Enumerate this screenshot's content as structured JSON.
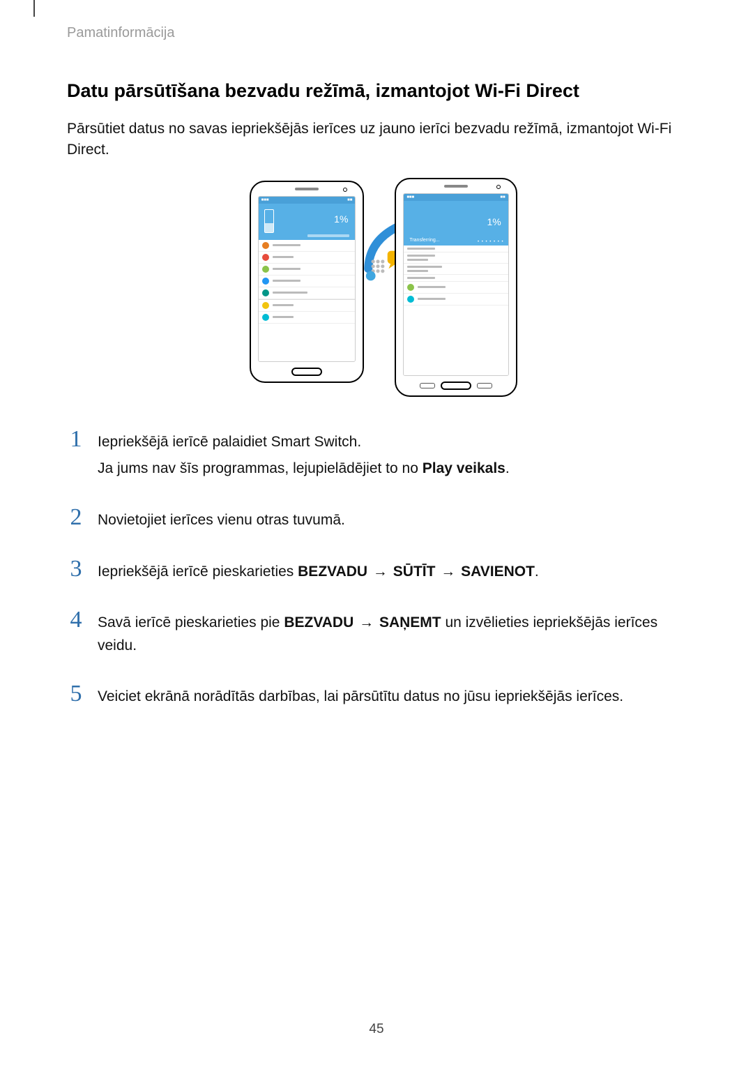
{
  "breadcrumb": "Pamatinformācija",
  "heading": "Datu pārsūtīšana bezvadu režīmā, izmantojot Wi-Fi Direct",
  "intro": "Pārsūtiet datus no savas iepriekšējās ierīces uz jauno ierīci bezvadu režīmā, izmantojot Wi-Fi Direct.",
  "illustration": {
    "percent": "1%",
    "transfer_label": "Transferring..."
  },
  "arrow_sep": "→",
  "steps": [
    {
      "num": "1",
      "lines": [
        {
          "type": "plain",
          "text": "Iepriekšējā ierīcē palaidiet Smart Switch."
        },
        {
          "type": "rich",
          "parts": [
            {
              "t": "Ja jums nav šīs programmas, lejupielādējiet to no "
            },
            {
              "t": "Play veikals",
              "bold": true
            },
            {
              "t": "."
            }
          ]
        }
      ]
    },
    {
      "num": "2",
      "lines": [
        {
          "type": "plain",
          "text": "Novietojiet ierīces vienu otras tuvumā."
        }
      ]
    },
    {
      "num": "3",
      "lines": [
        {
          "type": "rich",
          "parts": [
            {
              "t": "Iepriekšējā ierīcē pieskarieties "
            },
            {
              "t": "BEZVADU",
              "bold": true
            },
            {
              "sep": true
            },
            {
              "t": "SŪTĪT",
              "bold": true
            },
            {
              "sep": true
            },
            {
              "t": "SAVIENOT",
              "bold": true
            },
            {
              "t": "."
            }
          ]
        }
      ]
    },
    {
      "num": "4",
      "lines": [
        {
          "type": "rich",
          "parts": [
            {
              "t": "Savā ierīcē pieskarieties pie "
            },
            {
              "t": "BEZVADU",
              "bold": true
            },
            {
              "sep": true
            },
            {
              "t": "SAŅEMT",
              "bold": true
            },
            {
              "t": " un izvēlieties iepriekšējās ierīces veidu."
            }
          ]
        }
      ]
    },
    {
      "num": "5",
      "lines": [
        {
          "type": "plain",
          "text": "Veiciet ekrānā norādītās darbības, lai pārsūtītu datus no jūsu iepriekšējās ierīces."
        }
      ]
    }
  ],
  "page_number": "45"
}
